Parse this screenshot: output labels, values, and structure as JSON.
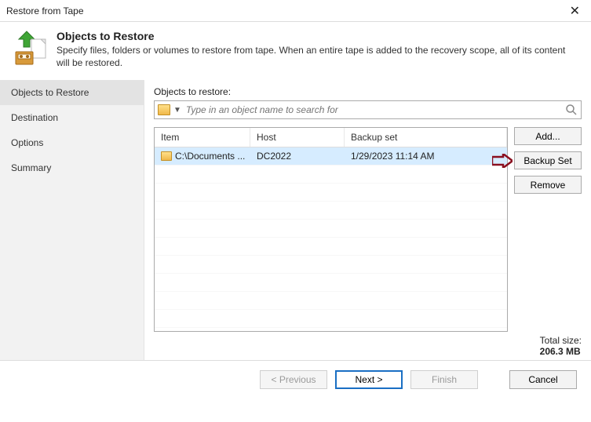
{
  "window": {
    "title": "Restore from Tape"
  },
  "header": {
    "title": "Objects to Restore",
    "subtitle": "Specify files, folders or volumes to restore from tape. When an entire tape is added to the recovery scope, all of its content will be restored."
  },
  "sidebar": {
    "steps": [
      {
        "label": "Objects to Restore",
        "active": true
      },
      {
        "label": "Destination",
        "active": false
      },
      {
        "label": "Options",
        "active": false
      },
      {
        "label": "Summary",
        "active": false
      }
    ]
  },
  "main": {
    "label": "Objects to restore:",
    "search_placeholder": "Type in an object name to search for",
    "columns": {
      "item": "Item",
      "host": "Host",
      "bset": "Backup set"
    },
    "rows": [
      {
        "item": "C:\\Documents ...",
        "host": "DC2022",
        "bset": "1/29/2023 11:14 AM"
      }
    ],
    "buttons": {
      "add": "Add...",
      "backup_set": "Backup Set",
      "remove": "Remove"
    },
    "totals": {
      "label": "Total size:",
      "value": "206.3 MB"
    }
  },
  "footer": {
    "previous": "< Previous",
    "next": "Next >",
    "finish": "Finish",
    "cancel": "Cancel"
  }
}
